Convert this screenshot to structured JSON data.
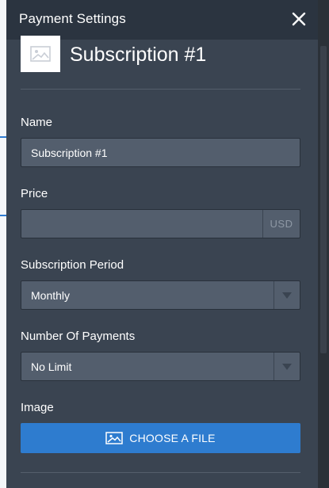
{
  "header": {
    "title": "Payment Settings",
    "close_icon": "close-icon"
  },
  "product": {
    "name": "Subscription #1",
    "thumbnail_icon": "image-placeholder-icon"
  },
  "fields": {
    "name": {
      "label": "Name",
      "value": "Subscription #1"
    },
    "price": {
      "label": "Price",
      "value": "",
      "suffix": "USD"
    },
    "period": {
      "label": "Subscription Period",
      "value": "Monthly",
      "arrow_icon": "caret-down-icon"
    },
    "payments": {
      "label": "Number Of Payments",
      "value": "No Limit",
      "arrow_icon": "caret-down-icon"
    },
    "image": {
      "label": "Image",
      "button_label": "CHOOSE A FILE",
      "button_icon": "image-icon"
    }
  },
  "colors": {
    "panel": "#3a4451",
    "header": "#2b3440",
    "field": "#535e6d",
    "accent": "#2e7ccf"
  }
}
